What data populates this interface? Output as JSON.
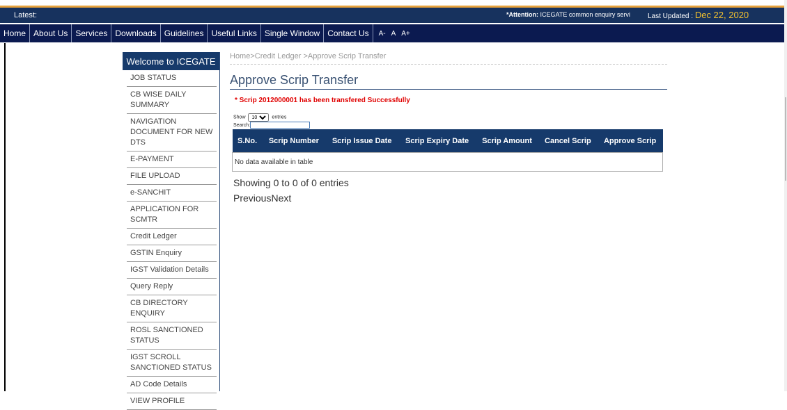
{
  "latest_bar": {
    "label": "Latest:",
    "attention_prefix": "*Attention:",
    "attention_text": " ICEGATE common enquiry servic",
    "updated_label": "Last Updated : ",
    "updated_date": "Dec 22, 2020"
  },
  "nav": {
    "items": [
      "Home",
      "About Us",
      "Services",
      "Downloads",
      "Guidelines",
      "Useful Links",
      "Single Window",
      "Contact Us"
    ],
    "font_sizes": [
      "A-",
      "A",
      "A+"
    ]
  },
  "sidebar": {
    "header": "Welcome to ICEGATE",
    "items": [
      "JOB STATUS",
      "CB WISE DAILY SUMMARY",
      "NAVIGATION DOCUMENT FOR NEW DTS",
      "E-PAYMENT",
      "FILE UPLOAD",
      "e-SANCHIT",
      "APPLICATION FOR SCMTR",
      "Credit Ledger",
      "GSTIN Enquiry",
      "IGST Validation Details",
      "Query Reply",
      "CB DIRECTORY ENQUIRY",
      "ROSL SANCTIONED STATUS",
      "IGST SCROLL SANCTIONED STATUS",
      "AD Code Details",
      "VIEW PROFILE"
    ]
  },
  "main": {
    "breadcrumb": "Home>Credit Ledger >Approve Scrip Transfer",
    "title": "Approve Scrip Transfer",
    "success": "* Scrip 2012000001 has been transfered Successfully",
    "show_label": "Show",
    "entries_label": "entries",
    "page_size": "10",
    "search_label": "Search:",
    "columns": [
      "S.No.",
      "Scrip Number",
      "Scrip Issue Date",
      "Scrip Expiry Date",
      "Scrip Amount",
      "Cancel Scrip",
      "Approve Scrip"
    ],
    "empty_text": "No data available in table",
    "info": "Showing 0 to 0 of 0 entries",
    "previous": "Previous",
    "next": "Next"
  },
  "colors": {
    "header_blue": "#17325e",
    "nav_dark": "#0b1a50",
    "accent_orange": "#e8a33d",
    "success_red": "#e00000",
    "date_yellow": "#f2c12e"
  }
}
